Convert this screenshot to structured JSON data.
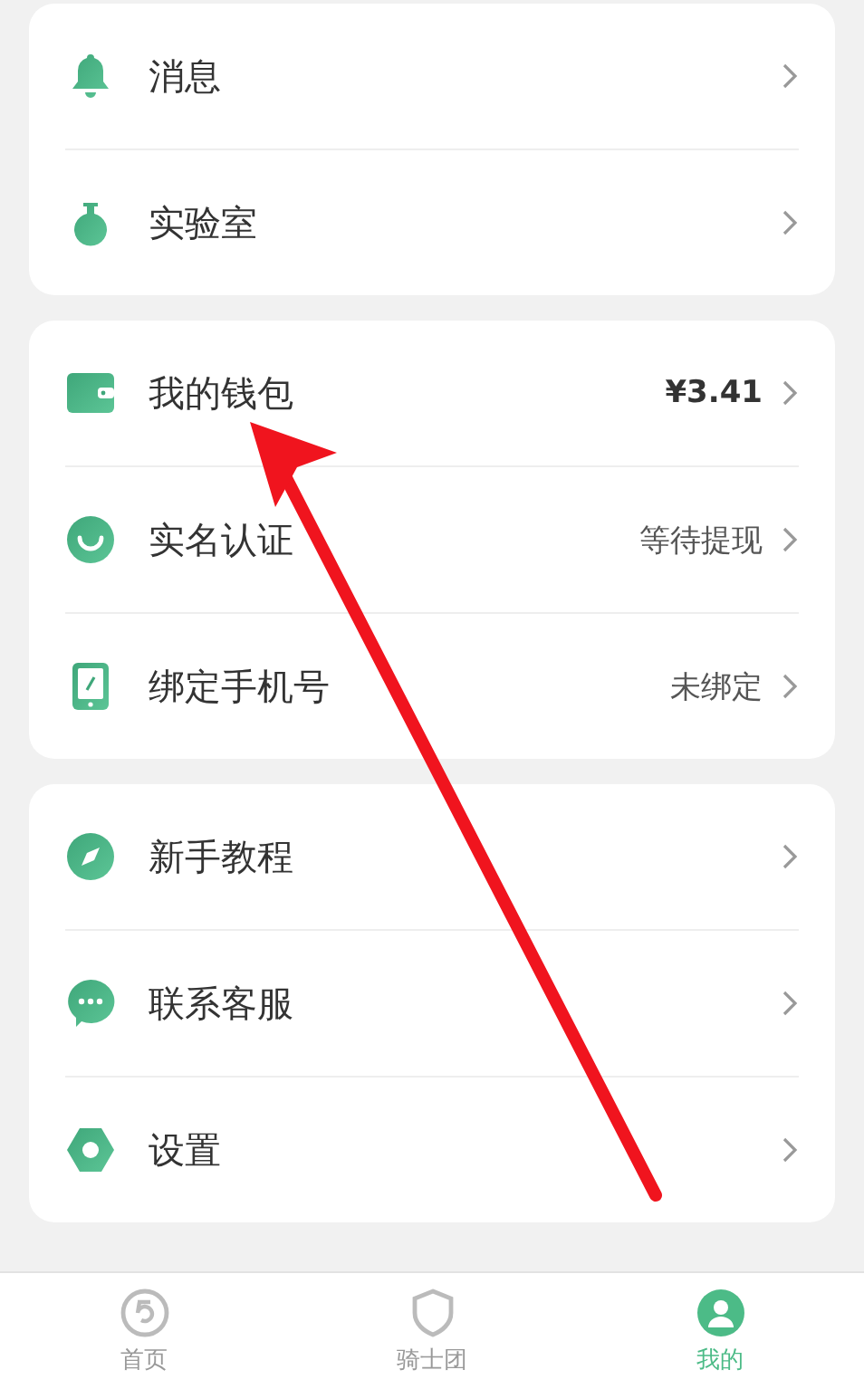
{
  "sections": [
    {
      "items": [
        {
          "label": "消息"
        },
        {
          "label": "实验室"
        }
      ]
    },
    {
      "items": [
        {
          "label": "我的钱包",
          "value": "¥3.41",
          "value_bold": true
        },
        {
          "label": "实名认证",
          "value": "等待提现",
          "value_bold": false
        },
        {
          "label": "绑定手机号",
          "value": "未绑定",
          "value_bold": false
        }
      ]
    },
    {
      "items": [
        {
          "label": "新手教程"
        },
        {
          "label": "联系客服"
        },
        {
          "label": "设置"
        }
      ]
    }
  ],
  "tabs": [
    {
      "label": "首页",
      "selected": false
    },
    {
      "label": "骑士团",
      "selected": false
    },
    {
      "label": "我的",
      "selected": true
    }
  ]
}
